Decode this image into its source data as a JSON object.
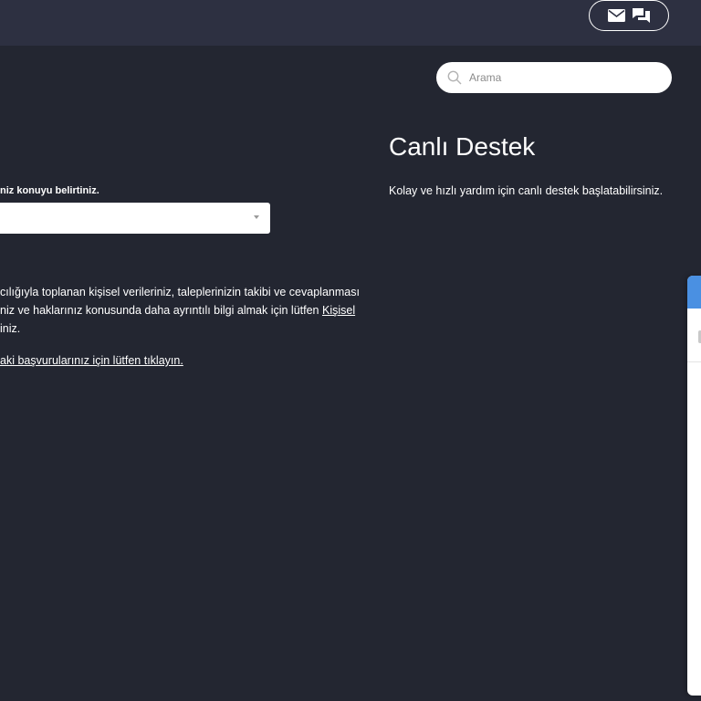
{
  "header": {
    "contact_icons": [
      "mail-icon",
      "chat-icon"
    ]
  },
  "search": {
    "placeholder": "Arama"
  },
  "form": {
    "topic_label": "niz konuyu belirtiniz.",
    "topic_select_value": ""
  },
  "kvkk": {
    "line1": "cılığıyla toplanan kişisel verileriniz, taleplerinizin takibi ve cevaplanması",
    "line2_text": "niz ve haklarınız konusunda daha ayrıntılı bilgi almak için lütfen ",
    "line2_link": "Kişisel",
    "line3": "iniz.",
    "apply_link": "aki başvurularınız için lütfen tıklayın."
  },
  "live_support": {
    "title": "Canlı Destek",
    "description": "Kolay ve hızlı yardım için canlı destek başlatabilirsiniz."
  },
  "colors": {
    "background": "#232631",
    "topbar": "#2d3041",
    "chat_header": "#4a90e2"
  }
}
